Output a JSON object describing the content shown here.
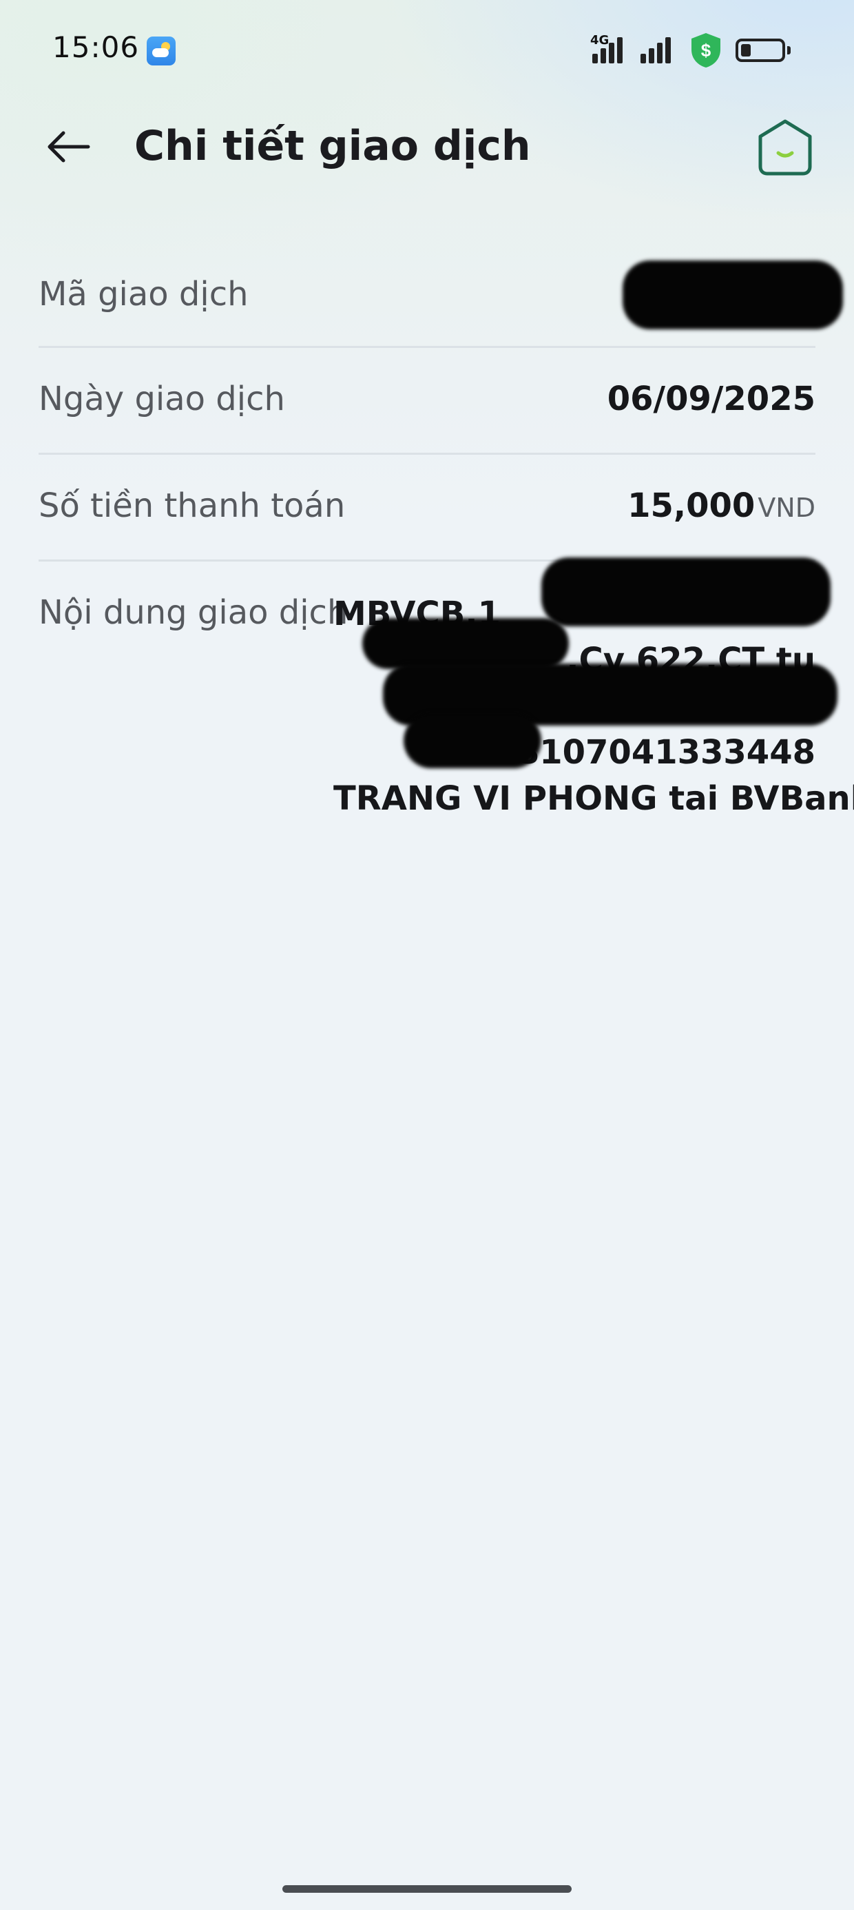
{
  "status_bar": {
    "time": "15:06",
    "network_type": "4G",
    "battery_level": 0.25,
    "icons": [
      "weather-icon",
      "signal-icon",
      "signal-icon",
      "security-shield-icon",
      "battery-icon"
    ]
  },
  "header": {
    "title": "Chi tiết giao dịch",
    "back_icon": "arrow-left-icon",
    "home_icon": "home-icon"
  },
  "details": {
    "transaction_id": {
      "label": "Mã giao dịch",
      "value": ""
    },
    "transaction_date": {
      "label": "Ngày giao dịch",
      "value": "06/09/2025"
    },
    "amount": {
      "label": "Số tiền thanh toán",
      "value": "15,000",
      "currency": "VND"
    },
    "content": {
      "label": "Nội dung giao dịch",
      "lines": [
        "MBVCB.1",
        ".Cv 622.CT tu",
        "",
        "toi 8107041333448",
        "TRANG VI PHONG tai BVBank"
      ]
    }
  },
  "colors": {
    "accent_green": "#1e6b52",
    "shield_green": "#2fb65a",
    "weather_blue": "#3a92ee"
  }
}
